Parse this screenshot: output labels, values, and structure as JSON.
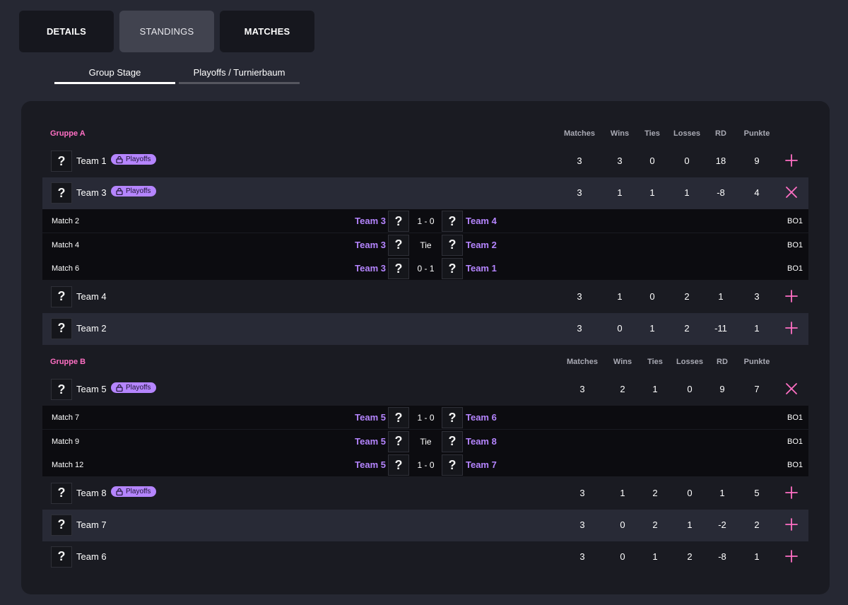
{
  "tabs": [
    {
      "label": "DETAILS",
      "active": false
    },
    {
      "label": "STANDINGS",
      "active": true
    },
    {
      "label": "MATCHES",
      "active": false
    }
  ],
  "subtabs": [
    {
      "label": "Group Stage",
      "active": true
    },
    {
      "label": "Playoffs / Turnierbaum",
      "active": false
    }
  ],
  "columns": [
    "Matches",
    "Wins",
    "Ties",
    "Losses",
    "RD",
    "Punkte"
  ],
  "logo_placeholder": "?",
  "playoffs_badge": "Playoffs",
  "colors": {
    "accent": "#ff6fc4",
    "team_purple": "#b585ff",
    "panel": "#1a1b22",
    "background": "#262833"
  },
  "groups": [
    {
      "name": "Gruppe A",
      "rows": [
        {
          "team": "Team 1",
          "playoffs": true,
          "matches": "3",
          "wins": "3",
          "ties": "0",
          "losses": "0",
          "rd": "18",
          "punkte": "9",
          "expanded": false
        },
        {
          "team": "Team 3",
          "playoffs": true,
          "matches": "3",
          "wins": "1",
          "ties": "1",
          "losses": "1",
          "rd": "-8",
          "punkte": "4",
          "expanded": true,
          "match_list": [
            {
              "label": "Match 2",
              "home": "Team 3",
              "score": "1 - 0",
              "away": "Team 4",
              "format": "BO1"
            },
            {
              "label": "Match 4",
              "home": "Team 3",
              "score": "Tie",
              "away": "Team 2",
              "format": "BO1"
            },
            {
              "label": "Match 6",
              "home": "Team 3",
              "score": "0 - 1",
              "away": "Team 1",
              "format": "BO1"
            }
          ]
        },
        {
          "team": "Team 4",
          "playoffs": false,
          "matches": "3",
          "wins": "1",
          "ties": "0",
          "losses": "2",
          "rd": "1",
          "punkte": "3",
          "expanded": false
        },
        {
          "team": "Team 2",
          "playoffs": false,
          "matches": "3",
          "wins": "0",
          "ties": "1",
          "losses": "2",
          "rd": "-11",
          "punkte": "1",
          "expanded": false
        }
      ]
    },
    {
      "name": "Gruppe B",
      "rows": [
        {
          "team": "Team 5",
          "playoffs": true,
          "matches": "3",
          "wins": "2",
          "ties": "1",
          "losses": "0",
          "rd": "9",
          "punkte": "7",
          "expanded": true,
          "match_list": [
            {
              "label": "Match 7",
              "home": "Team 5",
              "score": "1 - 0",
              "away": "Team 6",
              "format": "BO1"
            },
            {
              "label": "Match 9",
              "home": "Team 5",
              "score": "Tie",
              "away": "Team 8",
              "format": "BO1"
            },
            {
              "label": "Match 12",
              "home": "Team 5",
              "score": "1 - 0",
              "away": "Team 7",
              "format": "BO1"
            }
          ]
        },
        {
          "team": "Team 8",
          "playoffs": true,
          "matches": "3",
          "wins": "1",
          "ties": "2",
          "losses": "0",
          "rd": "1",
          "punkte": "5",
          "expanded": false
        },
        {
          "team": "Team 7",
          "playoffs": false,
          "matches": "3",
          "wins": "0",
          "ties": "2",
          "losses": "1",
          "rd": "-2",
          "punkte": "2",
          "expanded": false
        },
        {
          "team": "Team 6",
          "playoffs": false,
          "matches": "3",
          "wins": "0",
          "ties": "1",
          "losses": "2",
          "rd": "-8",
          "punkte": "1",
          "expanded": false
        }
      ]
    }
  ]
}
